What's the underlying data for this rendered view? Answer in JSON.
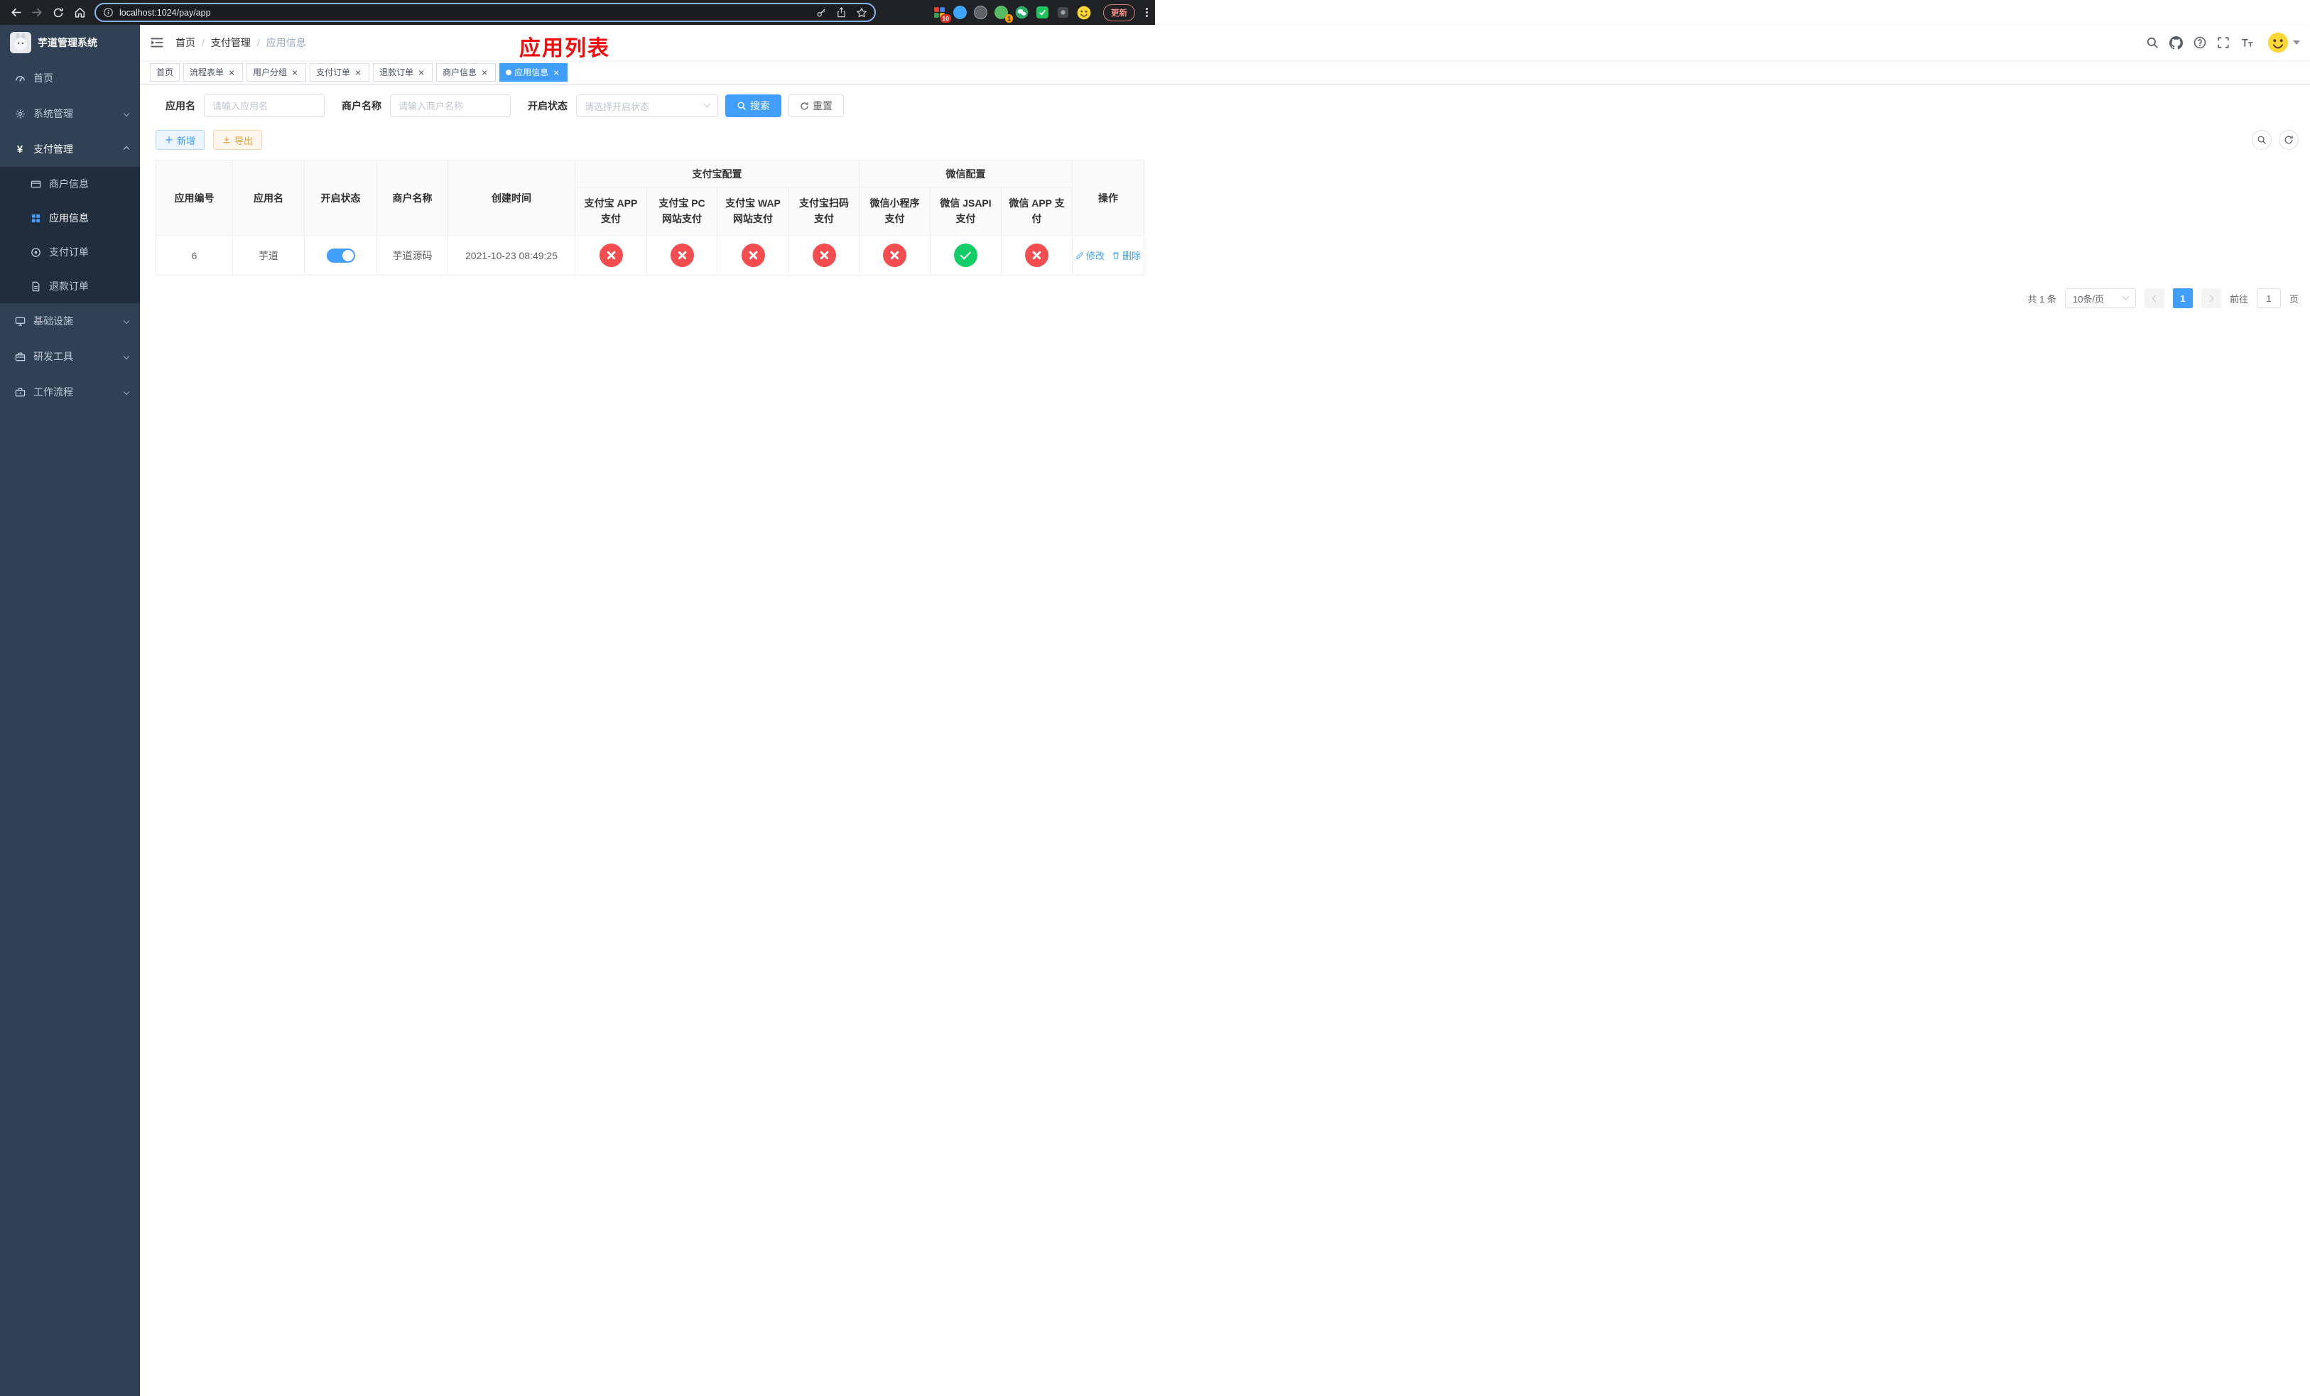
{
  "colors": {
    "primary": "#409eff",
    "danger": "#f34d50",
    "success": "#13ce66",
    "warning": "#e6a23c",
    "sidebar_bg": "#304156",
    "annotation_red": "#f20d0d"
  },
  "browser": {
    "url": "localhost:1024/pay/app",
    "update_label": "更新",
    "ext1_badge": "10",
    "ext4_badge": "1"
  },
  "sidebar": {
    "title": "芋道管理系统",
    "menu": [
      {
        "key": "home",
        "icon": "gauge",
        "label": "首页"
      },
      {
        "key": "system",
        "icon": "gear",
        "label": "系统管理",
        "expandable": true
      },
      {
        "key": "payment",
        "icon": "yen",
        "label": "支付管理",
        "expandable": true,
        "expanded": true,
        "active": true,
        "children": [
          {
            "key": "merchant-info",
            "icon": "card",
            "label": "商户信息"
          },
          {
            "key": "app-info",
            "icon": "grid",
            "label": "应用信息",
            "active": true
          },
          {
            "key": "pay-order",
            "icon": "target",
            "label": "支付订单"
          },
          {
            "key": "refund-order",
            "icon": "doc",
            "label": "退款订单"
          }
        ]
      },
      {
        "key": "infrastructure",
        "icon": "monitor",
        "label": "基础设施",
        "expandable": true
      },
      {
        "key": "dev-tools",
        "icon": "tools",
        "label": "研发工具",
        "expandable": true
      },
      {
        "key": "workflow",
        "icon": "briefcase",
        "label": "工作流程",
        "expandable": true
      }
    ]
  },
  "navbar": {
    "breadcrumb": [
      "首页",
      "支付管理",
      "应用信息"
    ],
    "annotation": "应用列表"
  },
  "tabs": [
    {
      "key": "home",
      "label": "首页",
      "closable": false,
      "active": false
    },
    {
      "key": "process-form",
      "label": "流程表单",
      "closable": true,
      "active": false
    },
    {
      "key": "user-group",
      "label": "用户分组",
      "closable": true,
      "active": false
    },
    {
      "key": "pay-order",
      "label": "支付订单",
      "closable": true,
      "active": false
    },
    {
      "key": "refund-order",
      "label": "退款订单",
      "closable": true,
      "active": false
    },
    {
      "key": "merchant-info",
      "label": "商户信息",
      "closable": true,
      "active": false
    },
    {
      "key": "app-info",
      "label": "应用信息",
      "closable": true,
      "active": true
    }
  ],
  "filters": {
    "app_name_label": "应用名",
    "app_name_placeholder": "请输入应用名",
    "merchant_label": "商户名称",
    "merchant_placeholder": "请输入商户名称",
    "status_label": "开启状态",
    "status_placeholder": "请选择开启状态",
    "search_label": "搜索",
    "reset_label": "重置"
  },
  "toolbar": {
    "add_label": "新增",
    "export_label": "导出"
  },
  "table": {
    "headers": {
      "app_id": "应用编号",
      "app_name": "应用名",
      "status": "开启状态",
      "merchant": "商户名称",
      "created": "创建时间",
      "alipay_group": "支付宝配置",
      "wechat_group": "微信配置",
      "alipay_cols": [
        "支付宝 APP 支付",
        "支付宝 PC 网站支付",
        "支付宝 WAP 网站支付",
        "支付宝扫码支付"
      ],
      "wechat_cols": [
        "微信小程序支付",
        "微信 JSAPI 支付",
        "微信 APP 支付"
      ],
      "ops": "操作"
    },
    "rows": [
      {
        "app_id": "6",
        "app_name": "芋道",
        "enabled": true,
        "merchant": "芋道源码",
        "created": "2021-10-23 08:49:25",
        "pay_channels": [
          "no",
          "no",
          "no",
          "no",
          "no",
          "yes",
          "no"
        ],
        "edit_label": "修改",
        "delete_label": "删除"
      }
    ]
  },
  "pagination": {
    "total": "共 1 条",
    "page_size": "10条/页",
    "current_page": "1",
    "goto_label": "前往",
    "goto_value": "1",
    "page_label": "页"
  }
}
